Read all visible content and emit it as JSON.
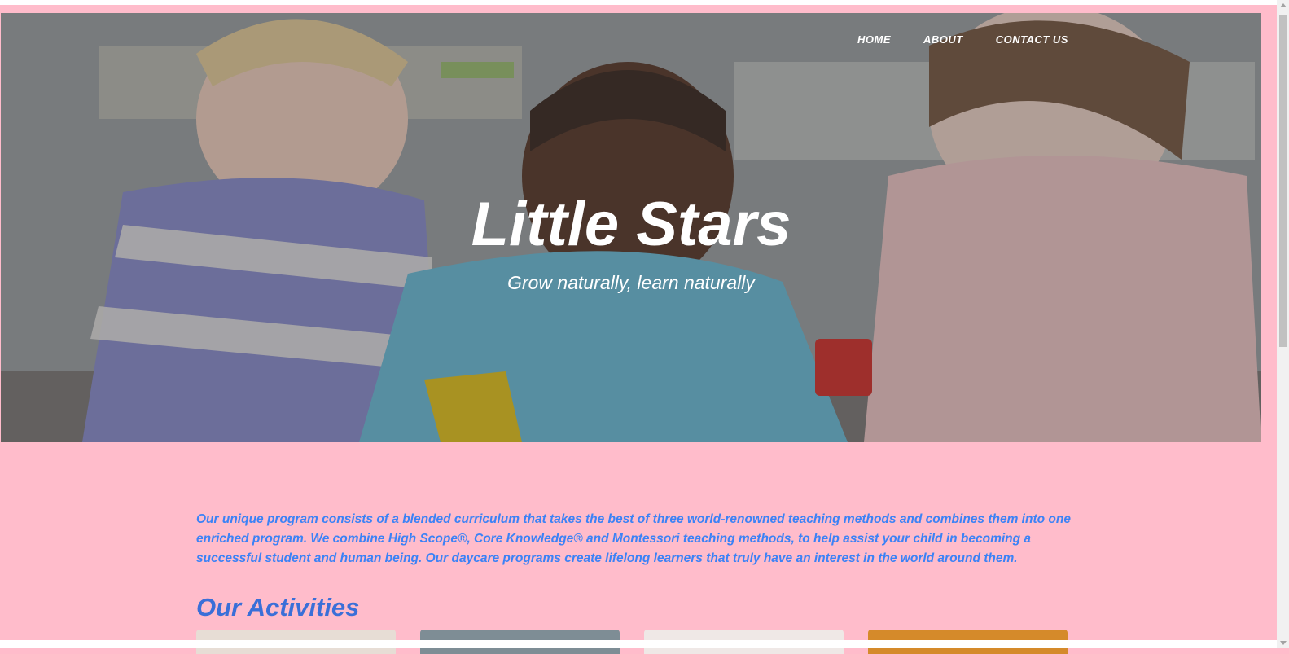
{
  "nav": {
    "items": [
      {
        "label": "HOME"
      },
      {
        "label": "ABOUT"
      },
      {
        "label": "CONTACT US"
      }
    ]
  },
  "hero": {
    "title": "Little Stars",
    "subtitle": "Grow naturally, learn naturally",
    "image_description_icon": "photo-children-playing"
  },
  "intro": {
    "text": "Our unique program consists of a blended curriculum that takes the best of three world-renowned teaching methods and combines them into one enriched program. We combine High Scope®, Core Knowledge® and Montessori teaching methods, to help assist your child in becoming a successful student and human being. Our daycare programs create lifelong learners that truly have an interest in the world around them."
  },
  "activities": {
    "title": "Our Activities",
    "cards": [
      {
        "color": "#e7ddd5"
      },
      {
        "color": "#7e8d95"
      },
      {
        "color": "#efe8e6"
      },
      {
        "color": "#d58a2a"
      }
    ]
  },
  "colors": {
    "background": "#ffbccb",
    "accent_text": "#3b82f6",
    "heading": "#3a6fd8"
  }
}
